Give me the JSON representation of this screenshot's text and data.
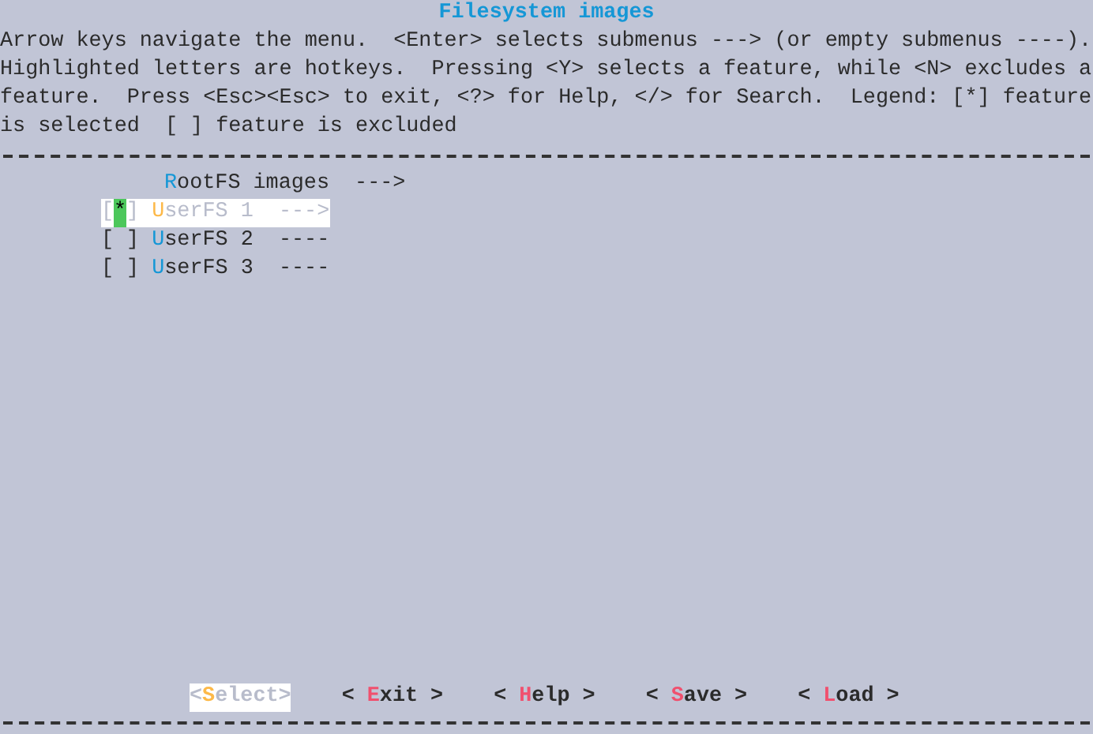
{
  "title": "Filesystem images",
  "help_lines": [
    "Arrow keys navigate the menu.  <Enter> selects submenus ---> (or empty submenus ----).",
    "Highlighted letters are hotkeys.  Pressing <Y> selects a feature, while <N> excludes a",
    "feature.  Press <Esc><Esc> to exit, <?> for Help, </> for Search.  Legend: [*] feature",
    "is selected  [ ] feature is excluded"
  ],
  "check_glyph": "*",
  "bracket_left": "[",
  "bracket_right": "]",
  "items": [
    {
      "kind": "menu",
      "hotkey": "R",
      "text": "ootFS images",
      "suffix": "--->",
      "selected": false
    },
    {
      "kind": "checkbox",
      "checked": true,
      "hotkey": "U",
      "text": "serFS 1",
      "suffix": "--->",
      "selected": true
    },
    {
      "kind": "checkbox",
      "checked": false,
      "hotkey": "U",
      "text": "serFS 2",
      "suffix": "----",
      "selected": false
    },
    {
      "kind": "checkbox",
      "checked": false,
      "hotkey": "U",
      "text": "serFS 3",
      "suffix": "----",
      "selected": false
    }
  ],
  "buttons": [
    {
      "left": "<",
      "hotkey": "S",
      "text": "elect",
      "right": ">",
      "selected": true
    },
    {
      "left": "<",
      "hotkey": "E",
      "text": "xit",
      "right": ">",
      "selected": false
    },
    {
      "left": "<",
      "hotkey": "H",
      "text": "elp",
      "right": ">",
      "selected": false
    },
    {
      "left": "<",
      "hotkey": "S",
      "text": "ave",
      "right": ">",
      "selected": false
    },
    {
      "left": "<",
      "hotkey": "L",
      "text": "oad",
      "right": ">",
      "selected": false
    }
  ]
}
